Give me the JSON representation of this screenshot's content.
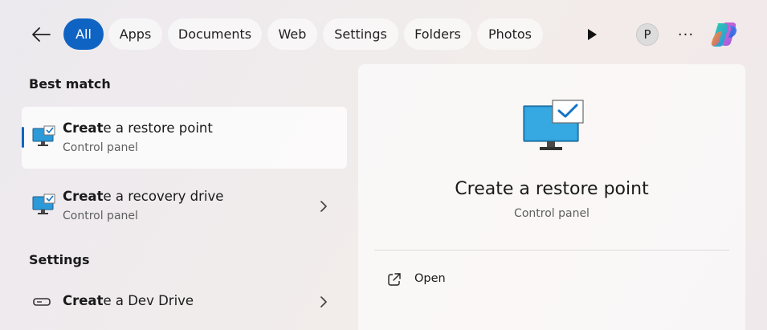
{
  "filters": {
    "all": "All",
    "apps": "Apps",
    "documents": "Documents",
    "web": "Web",
    "settings": "Settings",
    "folders": "Folders",
    "photos": "Photos"
  },
  "user": {
    "avatar_initial": "P"
  },
  "more_label": "···",
  "best_match": {
    "heading": "Best match",
    "title_bold": "Creat",
    "title_rest": "e a restore point",
    "subtitle": "Control panel"
  },
  "recovery": {
    "title_bold": "Creat",
    "title_rest": "e a recovery drive",
    "subtitle": "Control panel"
  },
  "settings_section": {
    "heading": "Settings",
    "title_bold": "Creat",
    "title_rest": "e a Dev Drive"
  },
  "preview": {
    "title": "Create a restore point",
    "subtitle": "Control panel",
    "open_label": "Open"
  },
  "colors": {
    "accent": "#0f64c3"
  },
  "icons": [
    "back-arrow-icon",
    "play-icon",
    "copilot-icon",
    "control-panel-monitor-icon",
    "drive-icon",
    "chevron-right-icon",
    "open-external-icon"
  ]
}
